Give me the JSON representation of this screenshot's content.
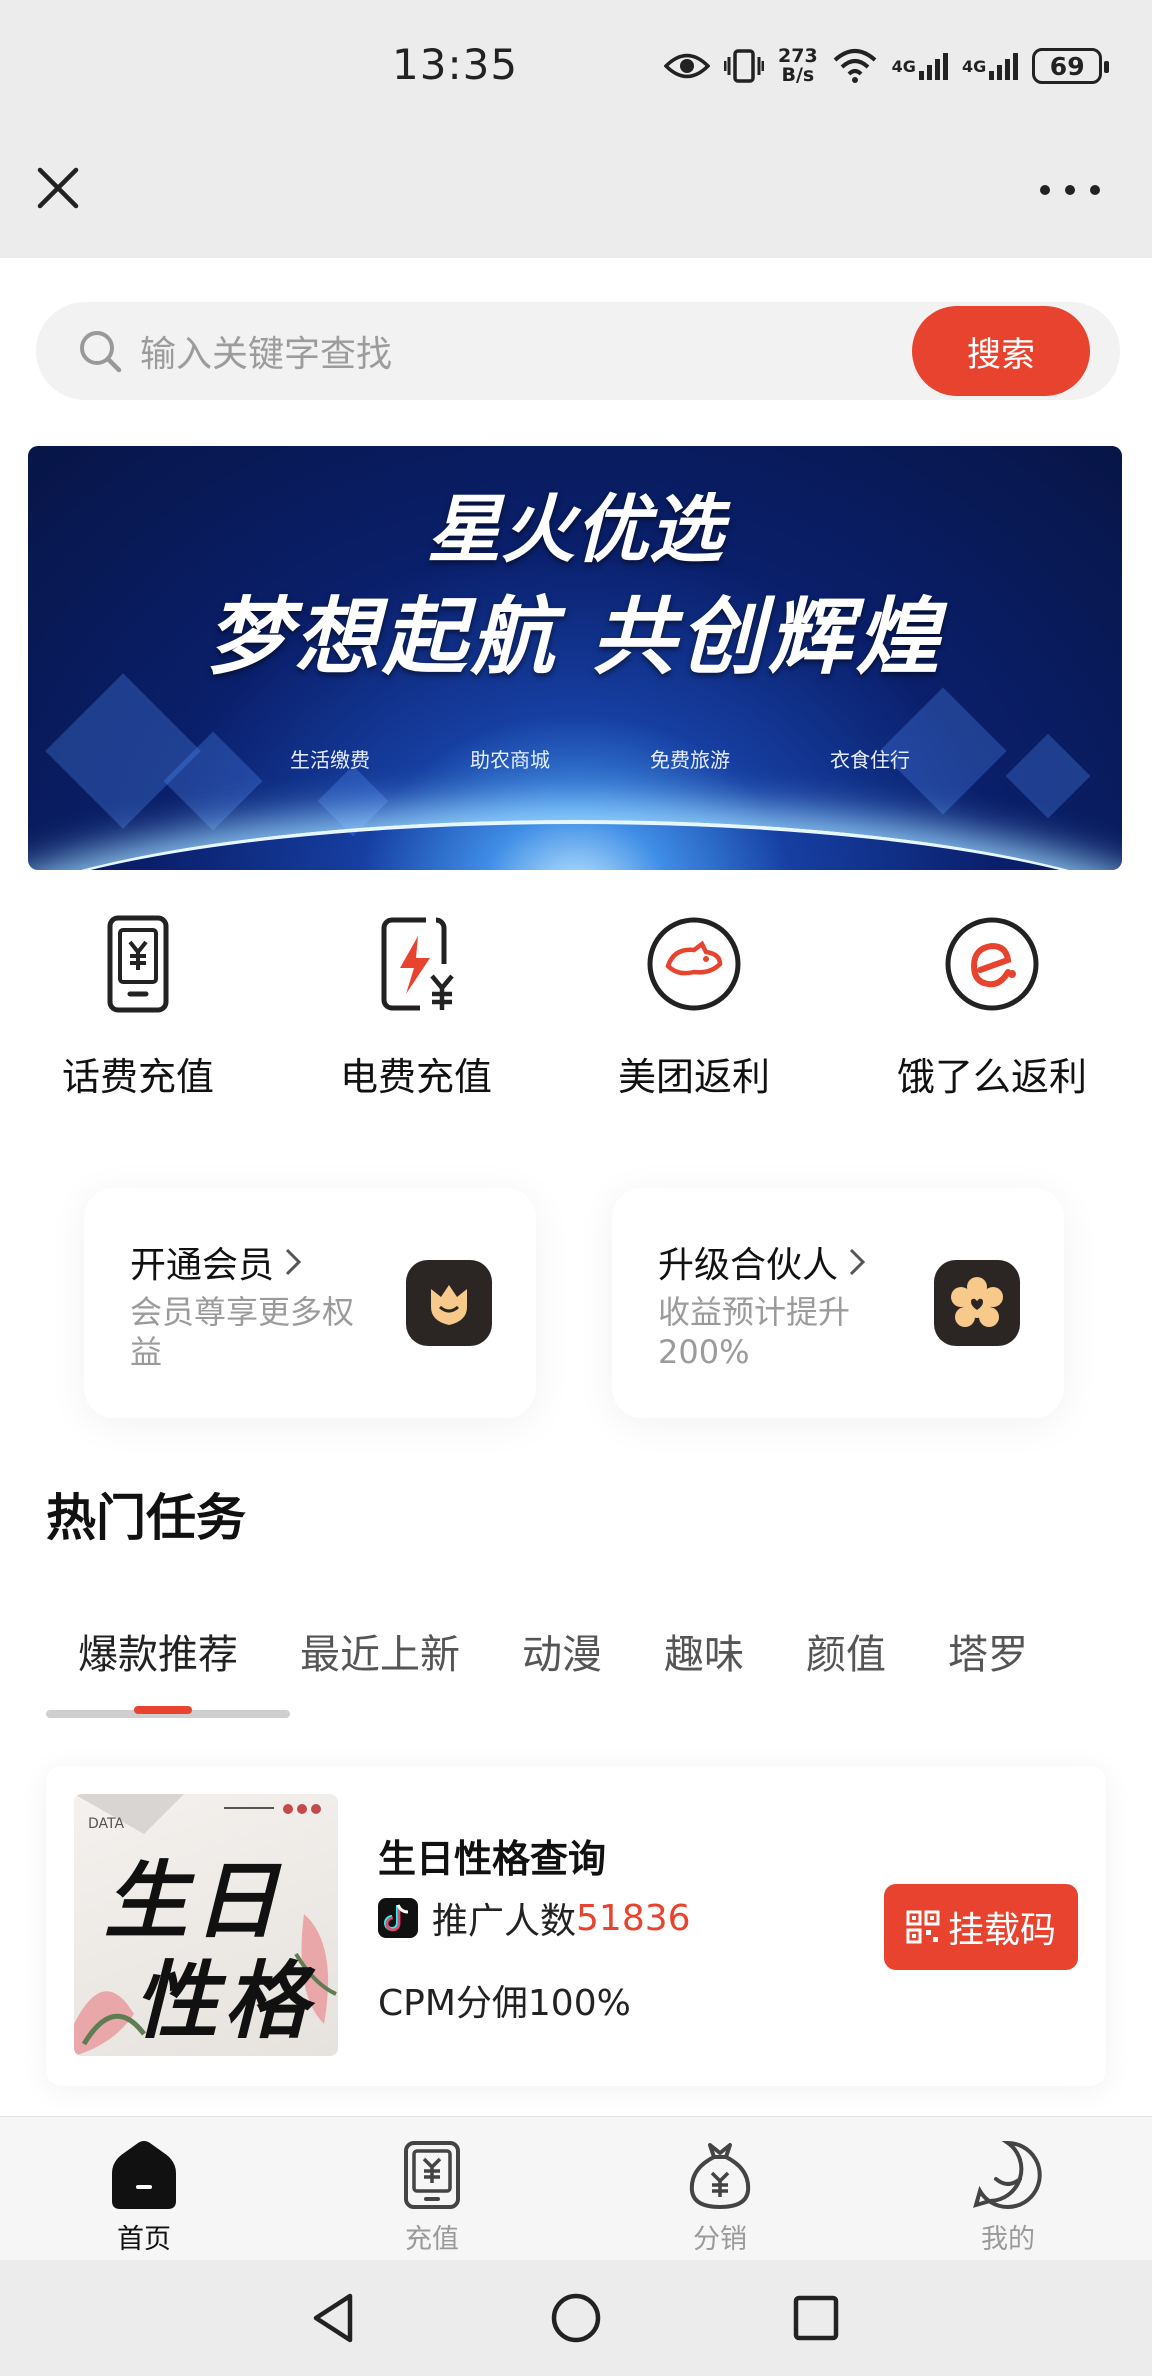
{
  "status_bar": {
    "time": "13:35",
    "net_speed_value": "273",
    "net_speed_unit": "B/s",
    "signal_1": "4G",
    "signal_2": "4G",
    "battery": "69"
  },
  "search": {
    "placeholder": "输入关键字查找",
    "button": "搜索"
  },
  "banner": {
    "title": "星火优选",
    "slogan": "梦想起航 共创辉煌",
    "tags": [
      "生活缴费",
      "助农商城",
      "免费旅游",
      "衣食住行"
    ]
  },
  "services": [
    {
      "label": "话费充值",
      "icon": "phone-bill-icon"
    },
    {
      "label": "电费充值",
      "icon": "electricity-bill-icon"
    },
    {
      "label": "美团返利",
      "icon": "meituan-icon"
    },
    {
      "label": "饿了么返利",
      "icon": "eleme-icon"
    }
  ],
  "cards": [
    {
      "title": "开通会员",
      "desc": "会员尊享更多权益",
      "icon": "crown-shield-icon"
    },
    {
      "title": "升级合伙人",
      "desc": "收益预计提升200%",
      "icon": "flower-heart-icon"
    }
  ],
  "hot": {
    "title": "热门任务",
    "tabs": [
      "爆款推荐",
      "最近上新",
      "动漫",
      "趣味",
      "颜值",
      "塔罗"
    ],
    "active_tab": 0
  },
  "task": {
    "thumb_line1": "生日",
    "thumb_line2": "性格",
    "thumb_tag": "DATA",
    "title": "生日性格查询",
    "promo_label": "推广人数",
    "promo_count": "51836",
    "cpm": "CPM分佣100%",
    "button": "挂载码"
  },
  "nav": [
    {
      "label": "首页",
      "icon": "home-icon",
      "active": true
    },
    {
      "label": "充值",
      "icon": "recharge-icon",
      "active": false
    },
    {
      "label": "分销",
      "icon": "money-bag-icon",
      "active": false
    },
    {
      "label": "我的",
      "icon": "smile-profile-icon",
      "active": false
    }
  ],
  "colors": {
    "accent": "#e8432e",
    "text": "#111111",
    "muted": "#9b9b9b"
  }
}
